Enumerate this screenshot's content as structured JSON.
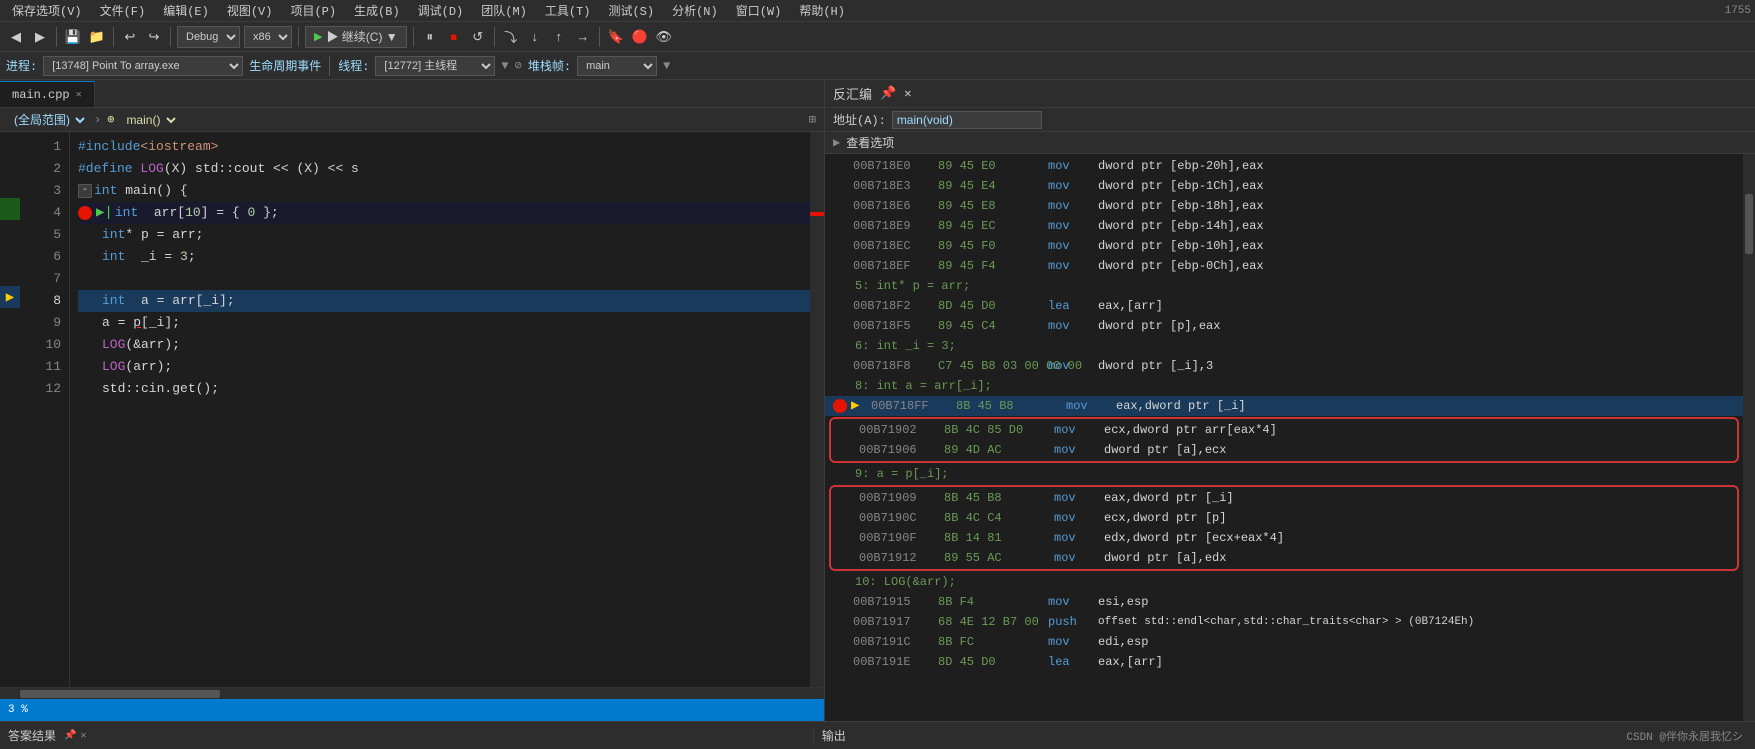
{
  "menuBar": {
    "items": [
      "保存选项(V)",
      "文件(F)",
      "编辑(E)",
      "视图(V)",
      "项目(P)",
      "生成(B)",
      "调试(D)",
      "团队(M)",
      "工具(T)",
      "测试(S)",
      "分析(N)",
      "窗口(W)",
      "帮助(H)"
    ]
  },
  "toolbar": {
    "backBtn": "◀",
    "forwardBtn": "▶",
    "debugConfig": "Debug",
    "platform": "x86",
    "playBtn": "▶ 继续(C) ▼",
    "pauseBtn": "⏸",
    "stopBtn": "⏹",
    "restartBtn": "↺",
    "stepOverBtn": "→",
    "stepInBtn": "↓",
    "stepOutBtn": "↑"
  },
  "debugBar": {
    "processLabel": "进程:",
    "processValue": "[13748] Point To array.exe",
    "lifecycleLabel": "生命周期事件",
    "threadLabel": "线程:",
    "threadValue": "[12772] 主线程",
    "stackLabel": "堆栈帧:",
    "stackValue": "main"
  },
  "editor": {
    "filename": "main.cpp",
    "scope": "(全局范围)",
    "function": "main()",
    "lines": [
      {
        "num": "1",
        "content": "#include<iostream>",
        "type": "normal"
      },
      {
        "num": "2",
        "content": "#define LOG(X) std::cout << (X) << s",
        "type": "normal"
      },
      {
        "num": "3",
        "content": "int main() {",
        "type": "normal",
        "collapsible": true
      },
      {
        "num": "4",
        "content": "    int  arr[10] = { 0 };",
        "type": "breakpoint_next"
      },
      {
        "num": "5",
        "content": "    int* p = arr;",
        "type": "normal"
      },
      {
        "num": "6",
        "content": "    int  _i = 3;",
        "type": "normal"
      },
      {
        "num": "7",
        "content": "",
        "type": "normal"
      },
      {
        "num": "8",
        "content": "    int  a = arr[_i];",
        "type": "current"
      },
      {
        "num": "9",
        "content": "    a = p[_i];",
        "type": "normal"
      },
      {
        "num": "10",
        "content": "    LOG(&arr);",
        "type": "normal"
      },
      {
        "num": "11",
        "content": "    LOG(arr);",
        "type": "normal"
      },
      {
        "num": "12",
        "content": "    std::cin.get();",
        "type": "normal"
      }
    ],
    "zoomLevel": "3 %"
  },
  "disassembly": {
    "title": "反汇编",
    "addressLabel": "地址(A):",
    "addressValue": "main(void)",
    "viewOptionsLabel": "查看选项",
    "lines": [
      {
        "addr": "00B718E0",
        "bytes": "89 45 E0",
        "instr": "mov",
        "operand": "dword ptr [ebp-20h],eax",
        "type": "normal"
      },
      {
        "addr": "00B718E3",
        "bytes": "89 45 E4",
        "instr": "mov",
        "operand": "dword ptr [ebp-1Ch],eax",
        "type": "normal"
      },
      {
        "addr": "00B718E6",
        "bytes": "89 45 E8",
        "instr": "mov",
        "operand": "dword ptr [ebp-18h],eax",
        "type": "normal"
      },
      {
        "addr": "00B718E9",
        "bytes": "89 45 EC",
        "instr": "mov",
        "operand": "dword ptr [ebp-14h],eax",
        "type": "normal"
      },
      {
        "addr": "00B718EC",
        "bytes": "89 45 F0",
        "instr": "mov",
        "operand": "dword ptr [ebp-10h],eax",
        "type": "normal"
      },
      {
        "addr": "00B718EF",
        "bytes": "89 45 F4",
        "instr": "mov",
        "operand": "dword ptr [ebp-0Ch],eax",
        "type": "normal"
      },
      {
        "src": "5:        int* p = arr;",
        "type": "src"
      },
      {
        "addr": "00B718F2",
        "bytes": "8D 45 D0",
        "instr": "lea",
        "operand": "eax,[arr]",
        "type": "normal"
      },
      {
        "addr": "00B718F5",
        "bytes": "89 45 C4",
        "instr": "mov",
        "operand": "dword ptr [p],eax",
        "type": "normal"
      },
      {
        "src": "6:        int _i = 3;",
        "type": "src"
      },
      {
        "addr": "00B718F8",
        "bytes": "C7 45 B8 03 00 00 00",
        "instr": "mov",
        "operand": "dword ptr [_i],3",
        "type": "normal"
      },
      {
        "src": "8:        int a = arr[_i];",
        "type": "src"
      },
      {
        "addr": "00B718FF",
        "bytes": "8B 45 B8",
        "instr": "mov",
        "operand": "eax,dword ptr [_i]",
        "type": "current",
        "hasBp": true
      },
      {
        "addr": "00B71902",
        "bytes": "8B 4C 85 D0",
        "instr": "mov",
        "operand": "ecx,dword ptr arr[eax*4]",
        "type": "circled1"
      },
      {
        "addr": "00B71906",
        "bytes": "89 4D AC",
        "instr": "mov",
        "operand": "dword ptr [a],ecx",
        "type": "circled1_end"
      },
      {
        "src": "9:        a = p[_i];",
        "type": "src"
      },
      {
        "addr": "00B71909",
        "bytes": "8B 45 B8",
        "instr": "mov",
        "operand": "eax,dword ptr [_i]",
        "type": "circled2"
      },
      {
        "addr": "00B7190C",
        "bytes": "8B 4C C4",
        "instr": "mov",
        "operand": "ecx,dword ptr [p]",
        "type": "circled2"
      },
      {
        "addr": "00B7190F",
        "bytes": "8B 14 81",
        "instr": "mov",
        "operand": "edx,dword ptr [ecx+eax*4]",
        "type": "circled2"
      },
      {
        "addr": "00B71912",
        "bytes": "89 55 AC",
        "instr": "mov",
        "operand": "dword ptr [a],edx",
        "type": "circled2_end"
      },
      {
        "src": "10:       LOG(&arr);",
        "type": "src"
      },
      {
        "addr": "00B71915",
        "bytes": "8B F4",
        "instr": "mov",
        "operand": "esi,esp",
        "type": "normal"
      },
      {
        "addr": "00B71917",
        "bytes": "68 4E 12 B7 00",
        "instr": "push",
        "operand": "offset std::endl<char,std::char_traits<char> > (0B7124Eh)",
        "type": "normal"
      },
      {
        "addr": "00B7191C",
        "bytes": "8B FC",
        "instr": "mov",
        "operand": "edi,esp",
        "type": "normal"
      },
      {
        "addr": "00B7191E",
        "bytes": "8D 45 D0",
        "instr": "lea",
        "operand": "eax,[arr]",
        "type": "normal"
      }
    ]
  },
  "bottomPanels": {
    "leftPanel": {
      "title": "答案结果"
    },
    "rightPanel": {
      "title": "输出"
    }
  },
  "statusBar": {
    "watermark": "CSDN @伴你永居我忆シ"
  }
}
